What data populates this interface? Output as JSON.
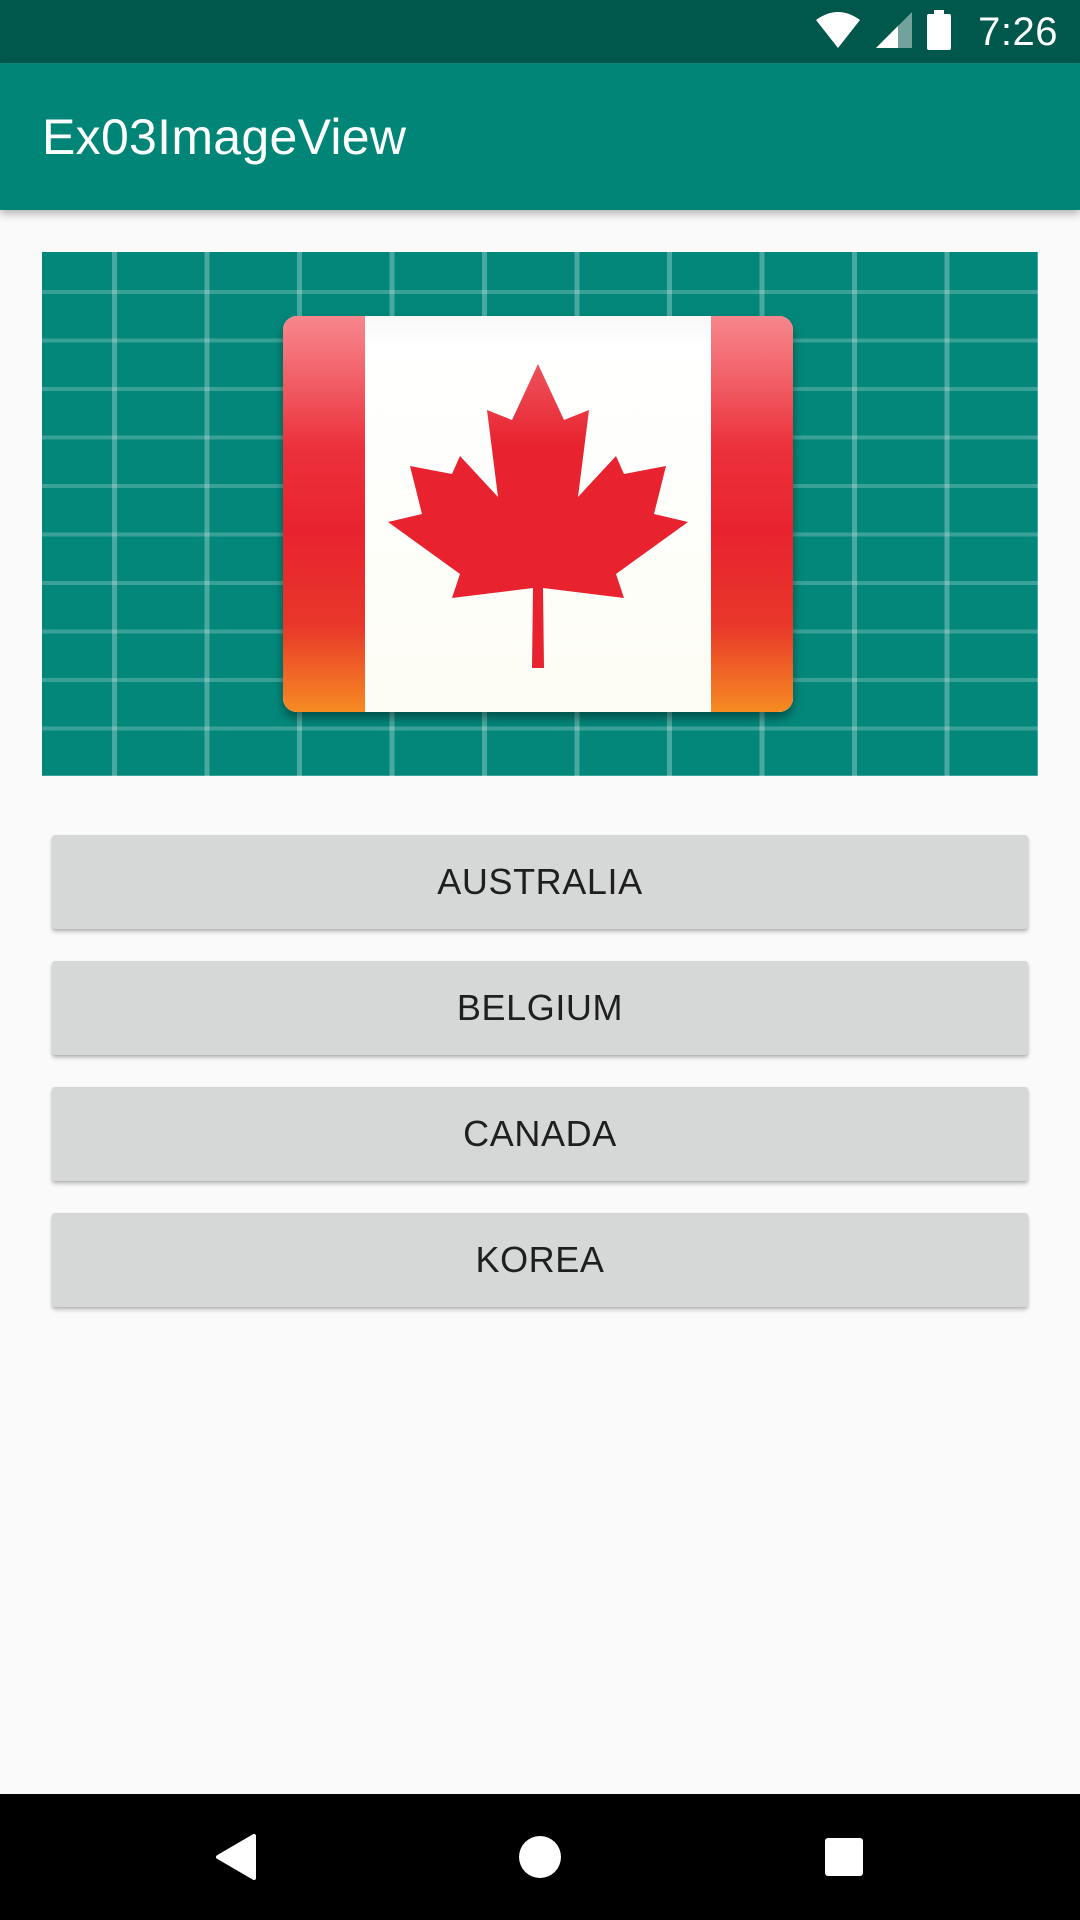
{
  "status_bar": {
    "time": "7:26",
    "icons": [
      "wifi-icon",
      "cell-signal-icon",
      "battery-icon"
    ]
  },
  "app_bar": {
    "title": "Ex03ImageView",
    "color": "#008577"
  },
  "image_view": {
    "image": "canada-flag",
    "background": "#03877a"
  },
  "buttons": [
    {
      "label": "AUSTRALIA"
    },
    {
      "label": "BELGIUM"
    },
    {
      "label": "CANADA"
    },
    {
      "label": "KOREA"
    }
  ],
  "nav_bar": {
    "icons": [
      "back-icon",
      "home-icon",
      "recents-icon"
    ]
  },
  "colors": {
    "status_bar": "#00574b",
    "app_bar": "#008577",
    "button": "#d6d7d7",
    "flag_red": "#e8232f"
  }
}
